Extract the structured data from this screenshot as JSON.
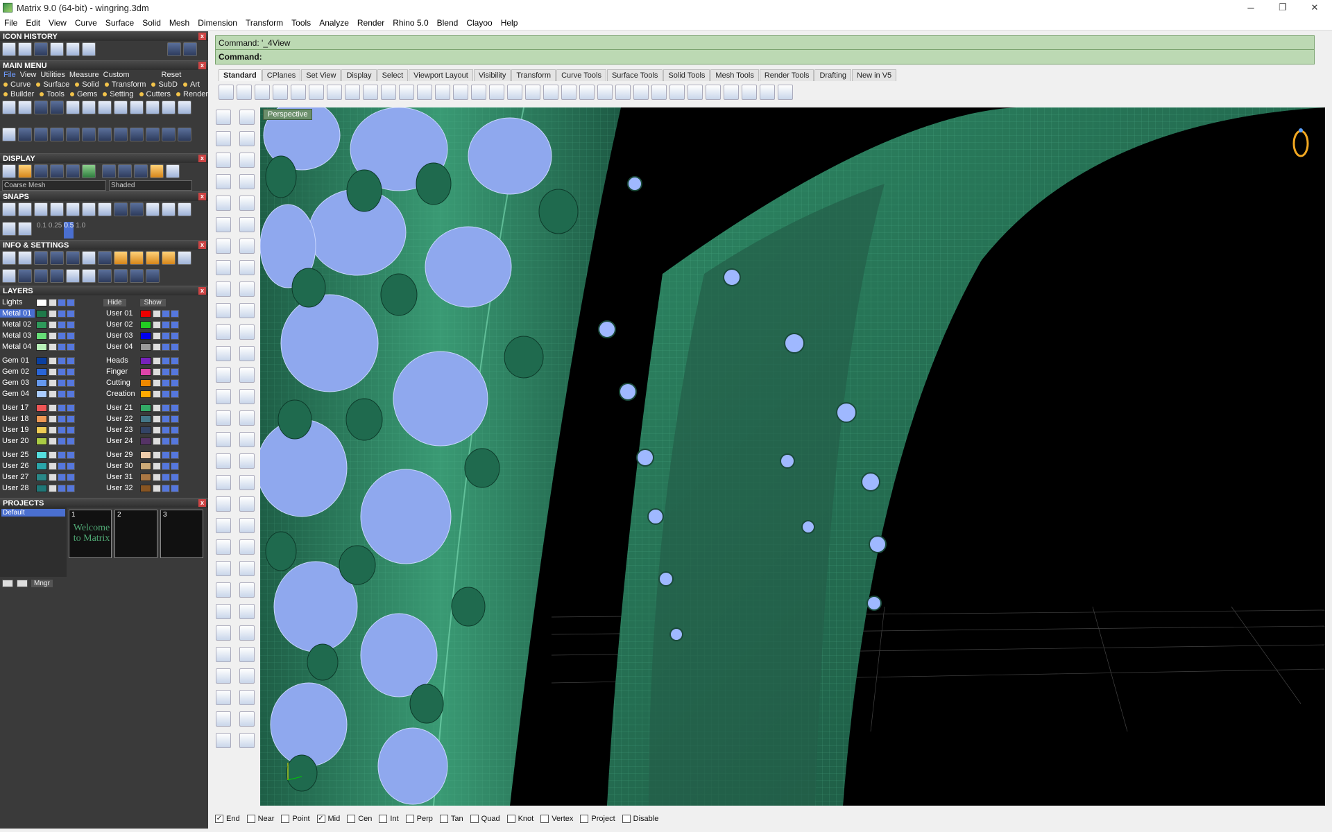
{
  "window": {
    "title": "Matrix 9.0 (64-bit) - wingring.3dm"
  },
  "menubar": [
    "File",
    "Edit",
    "View",
    "Curve",
    "Surface",
    "Solid",
    "Mesh",
    "Dimension",
    "Transform",
    "Tools",
    "Analyze",
    "Render",
    "Rhino 5.0",
    "Blend",
    "Clayoo",
    "Help"
  ],
  "left": {
    "icon_history": "ICON HISTORY",
    "main_menu": "MAIN MENU",
    "main_menu_tabs": [
      "File",
      "View",
      "Utilities",
      "Measure",
      "Custom",
      "Reset"
    ],
    "main_menu_row2": [
      "Curve",
      "Surface",
      "Solid",
      "Transform",
      "SubD",
      "Art"
    ],
    "main_menu_row3": [
      "Builder",
      "Tools",
      "Gems",
      "Setting",
      "Cutters",
      "Render"
    ],
    "display": "DISPLAY",
    "display_mesh": "Coarse Mesh",
    "display_mode": "Shaded",
    "snaps": "SNAPS",
    "snap_values": [
      "0.1",
      "0.25",
      "0.5",
      "1.0"
    ],
    "info": "INFO & SETTINGS",
    "layers": "LAYERS",
    "lights": "Lights",
    "hide": "Hide",
    "show": "Show",
    "layers_left": [
      {
        "name": "Metal 01",
        "color": "#1f7a4a"
      },
      {
        "name": "Metal 02",
        "color": "#2e9a5b"
      },
      {
        "name": "Metal 03",
        "color": "#66dd77"
      },
      {
        "name": "Metal 04",
        "color": "#b8f0b8"
      },
      {
        "name": "Gem 01",
        "color": "#0a3fa0"
      },
      {
        "name": "Gem 02",
        "color": "#2a66d8"
      },
      {
        "name": "Gem 03",
        "color": "#6699ee"
      },
      {
        "name": "Gem 04",
        "color": "#aaccff"
      },
      {
        "name": "User 17",
        "color": "#ee5555"
      },
      {
        "name": "User 18",
        "color": "#ee9955"
      },
      {
        "name": "User 19",
        "color": "#eecc55"
      },
      {
        "name": "User 20",
        "color": "#aacc44"
      },
      {
        "name": "User 25",
        "color": "#55dddd"
      },
      {
        "name": "User 26",
        "color": "#2aa6aa"
      },
      {
        "name": "User 27",
        "color": "#2a8888"
      },
      {
        "name": "User 28",
        "color": "#1f7777"
      }
    ],
    "layers_right": [
      {
        "name": "User 01",
        "color": "#ee0000"
      },
      {
        "name": "User 02",
        "color": "#22cc22"
      },
      {
        "name": "User 03",
        "color": "#0000ee"
      },
      {
        "name": "User 04",
        "color": "#999999"
      },
      {
        "name": "Heads",
        "color": "#7722bb"
      },
      {
        "name": "Finger",
        "color": "#dd44aa"
      },
      {
        "name": "Cutting",
        "color": "#ee8800"
      },
      {
        "name": "Creation",
        "color": "#ffaa00"
      },
      {
        "name": "User 21",
        "color": "#33aa66"
      },
      {
        "name": "User 22",
        "color": "#447788"
      },
      {
        "name": "User 23",
        "color": "#334466"
      },
      {
        "name": "User 24",
        "color": "#553366"
      },
      {
        "name": "User 29",
        "color": "#eeccaa"
      },
      {
        "name": "User 30",
        "color": "#ccaa77"
      },
      {
        "name": "User 31",
        "color": "#aa7744"
      },
      {
        "name": "User 32",
        "color": "#885522"
      }
    ],
    "projects": "PROJECTS",
    "project_default": "Default",
    "project_thumbs": [
      {
        "num": "1",
        "label": "Welcome to Matrix"
      },
      {
        "num": "2",
        "label": ""
      },
      {
        "num": "3",
        "label": ""
      }
    ],
    "mngr": "Mngr"
  },
  "command": {
    "line1": "Command: '_4View",
    "line2": "Command:"
  },
  "tabs": [
    "Standard",
    "CPlanes",
    "Set View",
    "Display",
    "Select",
    "Viewport Layout",
    "Visibility",
    "Transform",
    "Curve Tools",
    "Surface Tools",
    "Solid Tools",
    "Mesh Tools",
    "Render Tools",
    "Drafting",
    "New in V5"
  ],
  "viewport": {
    "label": "Perspective"
  },
  "osnaps": [
    {
      "label": "End",
      "checked": true
    },
    {
      "label": "Near",
      "checked": false
    },
    {
      "label": "Point",
      "checked": false
    },
    {
      "label": "Mid",
      "checked": true
    },
    {
      "label": "Cen",
      "checked": false
    },
    {
      "label": "Int",
      "checked": false
    },
    {
      "label": "Perp",
      "checked": false
    },
    {
      "label": "Tan",
      "checked": false
    },
    {
      "label": "Quad",
      "checked": false
    },
    {
      "label": "Knot",
      "checked": false
    },
    {
      "label": "Vertex",
      "checked": false
    },
    {
      "label": "Project",
      "checked": false
    },
    {
      "label": "Disable",
      "checked": false
    }
  ],
  "colors": {
    "accent": "#4a6fd0",
    "command_bg": "#bcd9b3",
    "metal": "#2e8a64",
    "gem": "#8fa8ee"
  }
}
